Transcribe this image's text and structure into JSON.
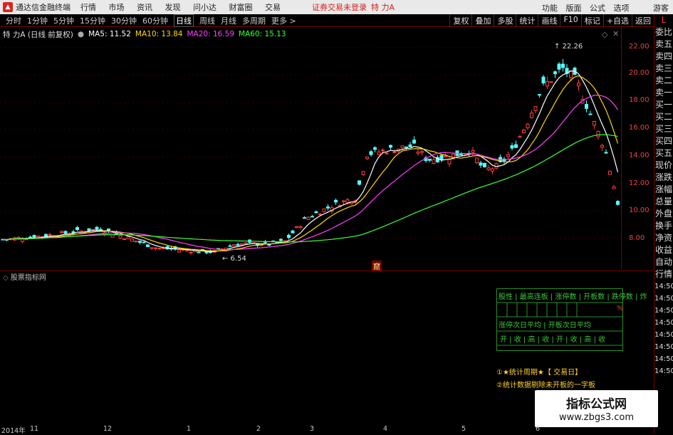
{
  "titlebar": {
    "app_name": "通达信金融终端",
    "menu": [
      "行情",
      "市场",
      "资讯",
      "发现",
      "问小达",
      "财富圈",
      "交易"
    ],
    "status": "证券交易未登录",
    "stock_name": "特 力A",
    "right": [
      "功能",
      "版面",
      "公式",
      "选项"
    ],
    "guest": "游客"
  },
  "period_bar": {
    "items": [
      "分时",
      "1分钟",
      "5分钟",
      "15分钟",
      "30分钟",
      "60分钟",
      "日线",
      "周线",
      "月线",
      "多周期",
      "更多 >"
    ],
    "active": "日线",
    "tools": [
      "复权",
      "叠加",
      "多股",
      "统计",
      "画线",
      "F10",
      "标记",
      "+自选",
      "返回"
    ]
  },
  "ma_line": {
    "stock": "特 力A (日线 前复权)",
    "ma5": "MA5: 11.52",
    "ma10": "MA10: 13.84",
    "ma20": "MA20: 16.59",
    "ma60": "MA60: 15.13",
    "colors": {
      "ma5": "#ffffff",
      "ma10": "#ffd700",
      "ma20": "#ff40ff",
      "ma60": "#39ff39"
    }
  },
  "price_axis": [
    "22.00",
    "20.00",
    "18.00",
    "16.00",
    "14.00",
    "12.00",
    "10.00",
    "8.00"
  ],
  "annotations": {
    "high": "22.26",
    "low": "6.54"
  },
  "side_panel": [
    "L",
    "委比",
    "卖五",
    "卖四",
    "卖三",
    "卖二",
    "卖一",
    "买一",
    "买二",
    "买三",
    "买四",
    "买五",
    "现价",
    "涨跌",
    "涨幅",
    "总量",
    "外盘",
    "换手",
    "净资",
    "收益",
    "自动",
    "行情",
    "14:50",
    "14:50",
    "14:50",
    "14:50",
    "14:50",
    "14:50",
    "14:50",
    "14:50"
  ],
  "indicator": {
    "header": "股票指标网",
    "table_row1": "股性 | 最高连板 | 涨停数 | 开板数 | 跌停数 | 炸",
    "percent": "%",
    "table_row2": "涨停次日平均 | 开板次日平均",
    "table_row3": [
      "开",
      "收",
      "高",
      "收",
      "开",
      "收",
      "高",
      "收"
    ],
    "note1": "①★统计周期★【 交易日】",
    "note2": "②统计数据剔除未开板的一字板"
  },
  "watermark": {
    "title": "指标公式网",
    "url": "www.zbgs3.com"
  },
  "dates": [
    "2014年",
    "11",
    "12",
    "1",
    "2",
    "3",
    "4",
    "5",
    "6"
  ],
  "pane_marker": "窟"
}
